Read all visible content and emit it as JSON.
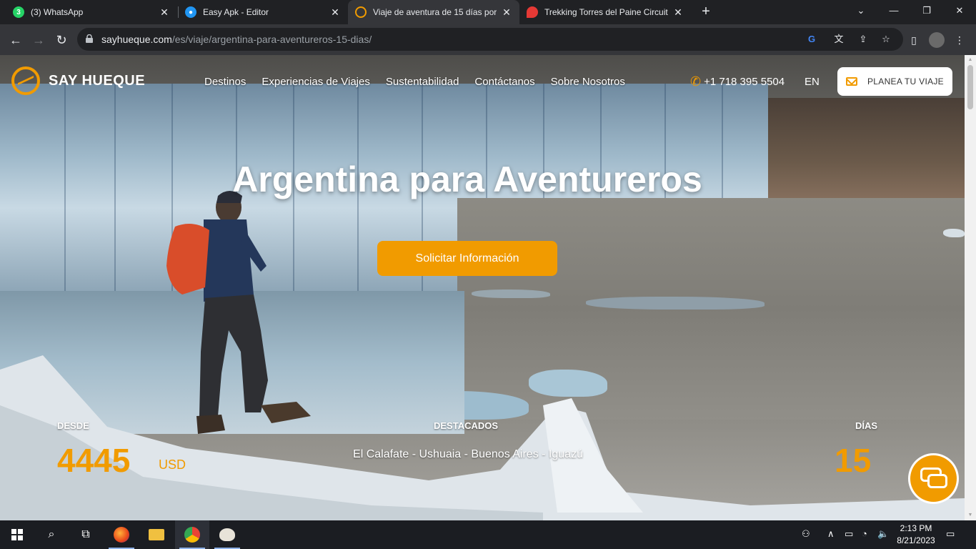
{
  "browser": {
    "tabs": [
      {
        "title": "(3) WhatsApp",
        "icon": "whatsapp-icon",
        "color": "#25d366",
        "badge": "3"
      },
      {
        "title": "Easy Apk - Editor",
        "icon": "android-icon",
        "color": "#2196f3"
      },
      {
        "title": "Viaje de aventura de 15 días por",
        "icon": "sayhueque-icon",
        "color": "#f19b00"
      },
      {
        "title": "Trekking Torres del Paine Circuito",
        "icon": "maps-pin-icon",
        "color": "#e53935"
      }
    ],
    "new_tab": "+",
    "url_host": "sayhueque.com",
    "url_path": "/es/viaje/argentina-para-aventureros-15-dias/"
  },
  "site": {
    "logo_text": "SAY HUEQUE",
    "nav": [
      "Destinos",
      "Experiencias de Viajes",
      "Sustentabilidad",
      "Contáctanos",
      "Sobre Nosotros"
    ],
    "phone": "+1 718 395 5504",
    "lang": "EN",
    "plan_button": "PLANEA TU VIAJE",
    "accent": "#f19b00"
  },
  "hero": {
    "title": "Argentina para Aventureros",
    "cta": "Solicitar Información",
    "stats": {
      "from_label": "DESDE",
      "price": "4445",
      "currency": "USD",
      "highlights_label": "DESTACADOS",
      "highlights": "El Calafate - Ushuaia - Buenos Aires - Iguazú",
      "days_label": "DÍAS",
      "days": "15"
    }
  },
  "taskbar": {
    "time": "2:13 PM",
    "date": "8/21/2023"
  }
}
